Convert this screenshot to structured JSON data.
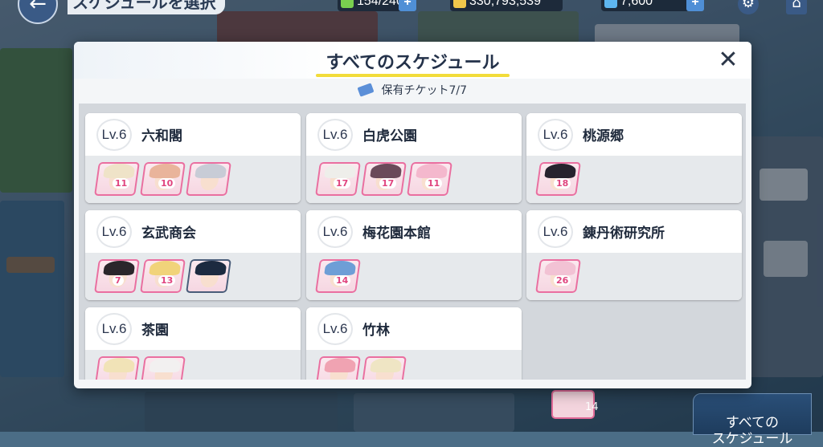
{
  "top_bar": {
    "title": "スケジュールを選択",
    "ap": "154/240",
    "credits": "330,793,539",
    "gems": "7,600",
    "back_icon": "arrow-left-icon",
    "gear_icon": "gear-icon",
    "home_icon": "home-icon"
  },
  "dialog": {
    "title": "すべてのスケジュール",
    "close_glyph": "✕",
    "ticket_label": "保有チケット7/7"
  },
  "locations": [
    {
      "level": "Lv.6",
      "name": "六和閣",
      "characters": [
        {
          "level": "11",
          "hair": "#efe3c8"
        },
        {
          "level": "10",
          "hair": "#e9b49b"
        },
        {
          "level": "",
          "hair": "#c8ccd6"
        }
      ]
    },
    {
      "level": "Lv.6",
      "name": "白虎公園",
      "characters": [
        {
          "level": "17",
          "hair": "#eeeeea"
        },
        {
          "level": "17",
          "hair": "#6a4a5a"
        },
        {
          "level": "11",
          "hair": "#f4b8cd"
        }
      ]
    },
    {
      "level": "Lv.6",
      "name": "桃源郷",
      "characters": [
        {
          "level": "18",
          "hair": "#26232e"
        }
      ]
    },
    {
      "level": "Lv.6",
      "name": "玄武商会",
      "characters": [
        {
          "level": "7",
          "hair": "#2a262b"
        },
        {
          "level": "13",
          "hair": "#f1d37a"
        },
        {
          "level": "",
          "hair": "#1c2a40"
        }
      ]
    },
    {
      "level": "Lv.6",
      "name": "梅花園本館",
      "characters": [
        {
          "level": "14",
          "hair": "#6e9ed6"
        }
      ]
    },
    {
      "level": "Lv.6",
      "name": "錬丹術研究所",
      "characters": [
        {
          "level": "26",
          "hair": "#f2c2d4"
        }
      ]
    },
    {
      "level": "Lv.6",
      "name": "茶園",
      "characters": [
        {
          "level": "",
          "hair": "#f1e3b7"
        },
        {
          "level": "",
          "hair": "#f2f0f0"
        }
      ]
    },
    {
      "level": "Lv.6",
      "name": "竹林",
      "characters": [
        {
          "level": "",
          "hair": "#f0a3b2"
        },
        {
          "level": "",
          "hair": "#efe5c4"
        }
      ]
    }
  ],
  "bottom_button": "すべての\nスケジュール",
  "bg_portrait_level": "14",
  "colors": {
    "accent_yellow": "#f2dc3a",
    "portrait_border": "#ea6fa0",
    "level_text": "#e0457f"
  }
}
